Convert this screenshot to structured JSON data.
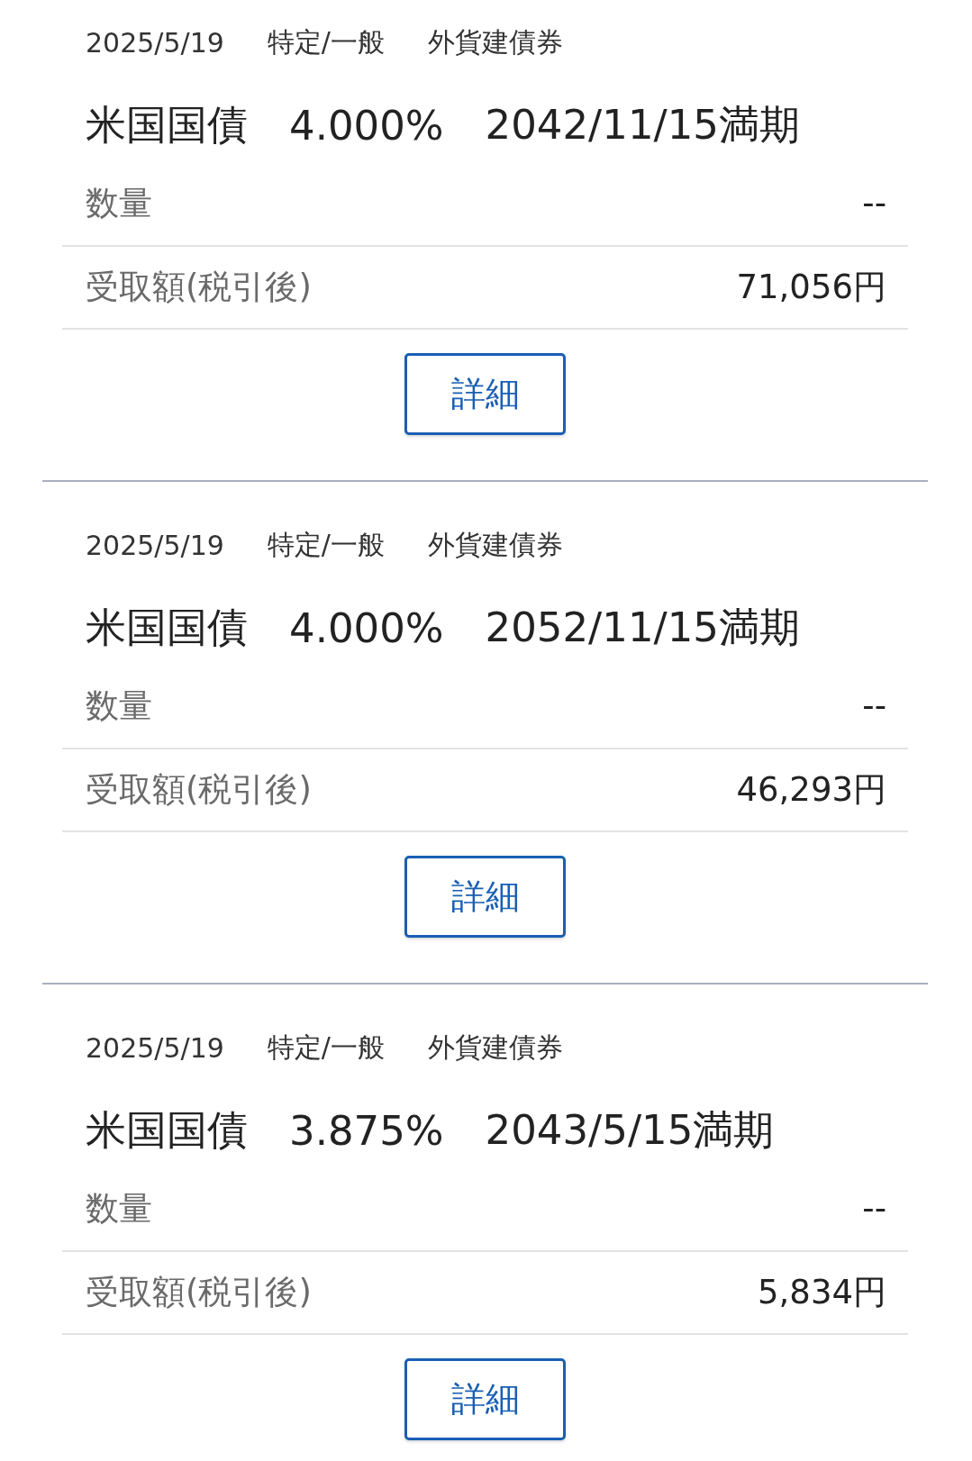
{
  "entries": [
    {
      "date": "2025/5/19",
      "account": "特定/一般",
      "category": "外貨建債券",
      "name": "米国国債",
      "rate": "4.000%",
      "maturity": "2042/11/15満期",
      "rows": [
        {
          "label": "数量",
          "value": "--"
        },
        {
          "label": "受取額(税引後)",
          "value": "71,056円"
        }
      ],
      "button": "詳細"
    },
    {
      "date": "2025/5/19",
      "account": "特定/一般",
      "category": "外貨建債券",
      "name": "米国国債",
      "rate": "4.000%",
      "maturity": "2052/11/15満期",
      "rows": [
        {
          "label": "数量",
          "value": "--"
        },
        {
          "label": "受取額(税引後)",
          "value": "46,293円"
        }
      ],
      "button": "詳細"
    },
    {
      "date": "2025/5/19",
      "account": "特定/一般",
      "category": "外貨建債券",
      "name": "米国国債",
      "rate": "3.875%",
      "maturity": "2043/5/15満期",
      "rows": [
        {
          "label": "数量",
          "value": "--"
        },
        {
          "label": "受取額(税引後)",
          "value": "5,834円"
        }
      ],
      "button": "詳細"
    }
  ]
}
